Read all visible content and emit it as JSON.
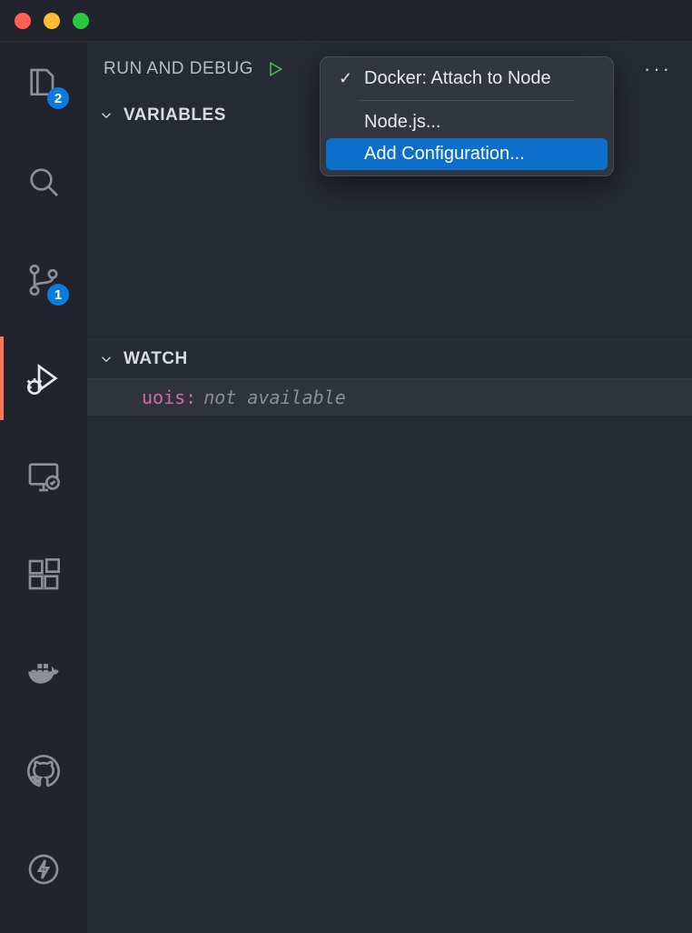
{
  "panel": {
    "title": "RUN AND DEBUG"
  },
  "sections": {
    "variables": {
      "title": "VARIABLES"
    },
    "watch": {
      "title": "WATCH",
      "items": [
        {
          "key": "uois:",
          "value": "not available"
        }
      ]
    }
  },
  "activity": {
    "explorer_badge": "2",
    "scm_badge": "1"
  },
  "dropdown": {
    "selected": "Docker: Attach to Node",
    "nodejs": "Node.js...",
    "add_config": "Add Configuration..."
  }
}
